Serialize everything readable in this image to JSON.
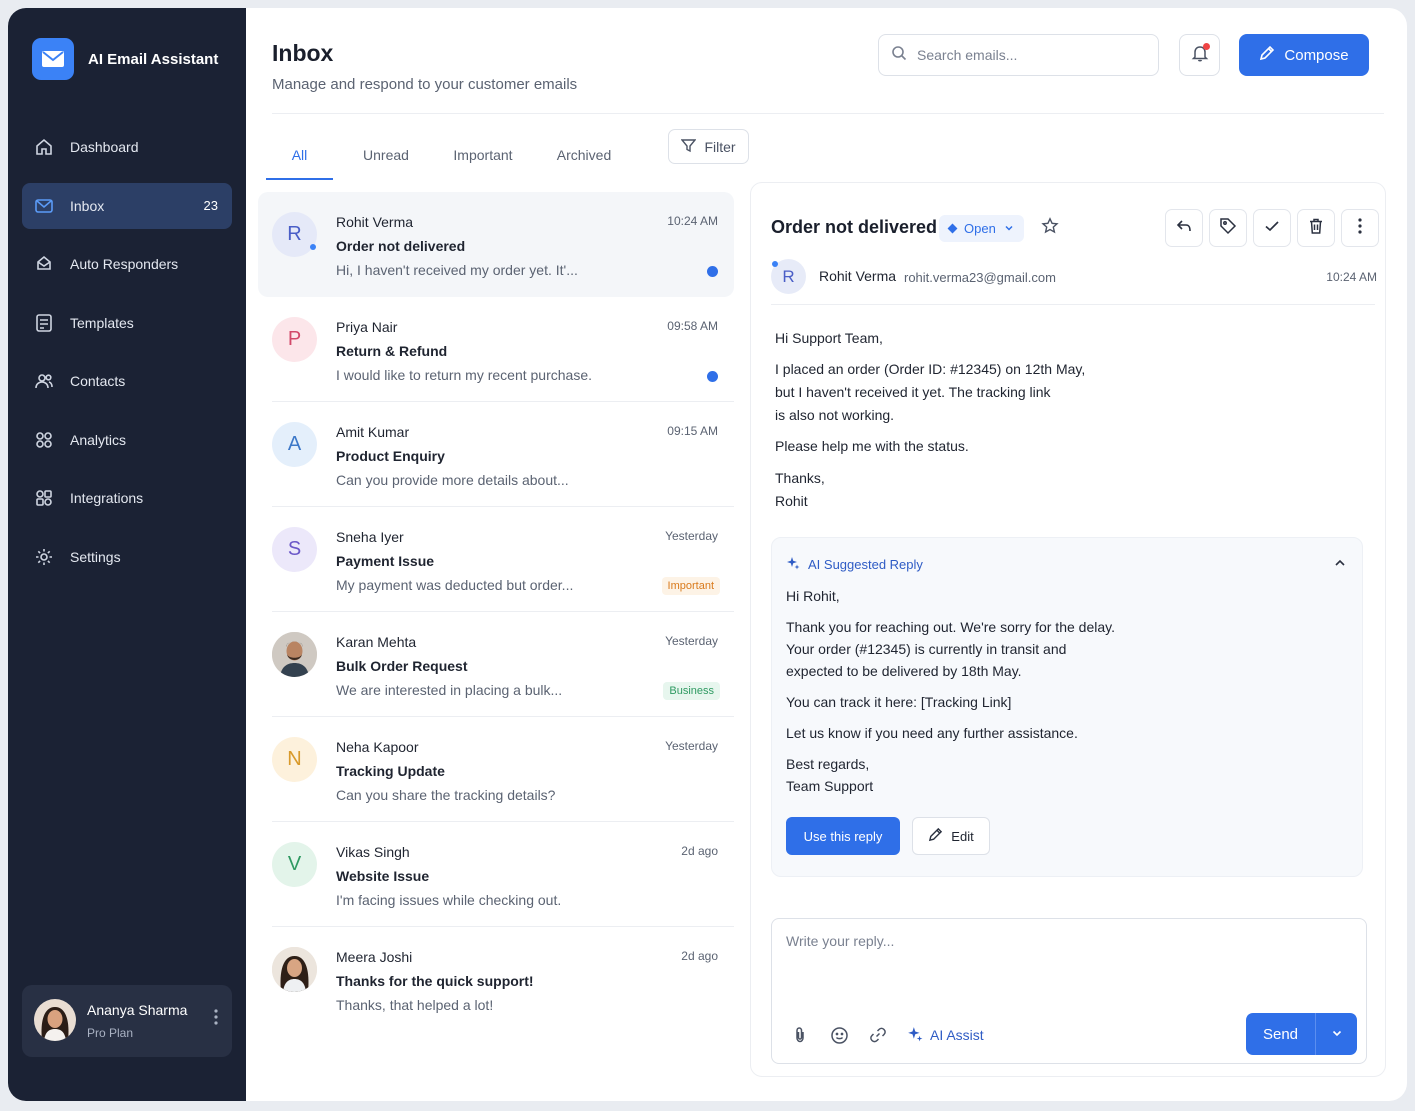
{
  "brand": {
    "name": "AI Email Assistant"
  },
  "sidebar": {
    "items": [
      {
        "label": "Dashboard",
        "icon": "home-icon"
      },
      {
        "label": "Inbox",
        "icon": "mail-icon",
        "count": "23"
      },
      {
        "label": "Auto Responders",
        "icon": "auto-responder-icon"
      },
      {
        "label": "Templates",
        "icon": "template-icon"
      },
      {
        "label": "Contacts",
        "icon": "contacts-icon"
      },
      {
        "label": "Analytics",
        "icon": "analytics-icon"
      },
      {
        "label": "Integrations",
        "icon": "integrations-icon"
      },
      {
        "label": "Settings",
        "icon": "gear-icon"
      }
    ],
    "user": {
      "name": "Ananya Sharma",
      "plan": "Pro Plan"
    }
  },
  "header": {
    "title": "Inbox",
    "subtitle": "Manage and respond to your customer emails",
    "search_placeholder": "Search emails...",
    "compose_label": "Compose"
  },
  "tabs": [
    {
      "label": "All",
      "active": true
    },
    {
      "label": "Unread"
    },
    {
      "label": "Important"
    },
    {
      "label": "Archived"
    }
  ],
  "filter_label": "Filter",
  "emails": [
    {
      "initial": "R",
      "sender": "Rohit Verma",
      "subject": "Order not delivered",
      "preview": "Hi, I haven't received my order yet. It'...",
      "time": "10:24 AM",
      "unread": true
    },
    {
      "initial": "P",
      "sender": "Priya Nair",
      "subject": "Return & Refund",
      "preview": "I would like to return my recent purchase.",
      "time": "09:58 AM",
      "unread": true
    },
    {
      "initial": "A",
      "sender": "Amit Kumar",
      "subject": "Product Enquiry",
      "preview": "Can you provide more details about...",
      "time": "09:15 AM"
    },
    {
      "initial": "S",
      "sender": "Sneha Iyer",
      "subject": "Payment Issue",
      "preview": "My payment was deducted but order...",
      "time": "Yesterday",
      "tag": "Important"
    },
    {
      "initial": "",
      "sender": "Karan Mehta",
      "subject": "Bulk Order Request",
      "preview": "We are interested in placing a bulk...",
      "time": "Yesterday",
      "tag": "Business"
    },
    {
      "initial": "N",
      "sender": "Neha Kapoor",
      "subject": "Tracking Update",
      "preview": "Can you share the tracking details?",
      "time": "Yesterday"
    },
    {
      "initial": "V",
      "sender": "Vikas Singh",
      "subject": "Website Issue",
      "preview": "I'm facing issues while checking out.",
      "time": "2d ago"
    },
    {
      "initial": "",
      "sender": "Meera Joshi",
      "subject": "Thanks for the quick support!",
      "preview": "Thanks, that helped a lot!",
      "time": "2d ago"
    }
  ],
  "detail": {
    "subject": "Order not delivered",
    "status": "Open",
    "from_initial": "R",
    "from_name": "Rohit Verma",
    "from_email": "rohit.verma23@gmail.com",
    "time": "10:24 AM",
    "body": [
      "Hi Support Team,",
      "I placed an order (Order ID: #12345) on 12th May,",
      "but I haven't received it yet. The tracking link",
      "is also not working.",
      "Please help me with the status.",
      "Thanks,",
      "Rohit"
    ]
  },
  "ai_reply": {
    "title": "AI Suggested Reply",
    "lines": [
      "Hi Rohit,",
      "Thank you for reaching out. We're sorry for the delay.",
      "Your order (#12345) is currently in transit and",
      "expected to be delivered by 18th May.",
      "You can track it here: [Tracking Link]",
      "Let us know if you need any further assistance.",
      "Best regards,",
      "Team Support"
    ],
    "use_label": "Use this reply",
    "edit_label": "Edit"
  },
  "reply": {
    "placeholder": "Write your reply...",
    "ai_assist_label": "AI Assist",
    "send_label": "Send"
  },
  "colors": {
    "accent": "#2f6fe8",
    "sidebar": "#1b2234"
  }
}
